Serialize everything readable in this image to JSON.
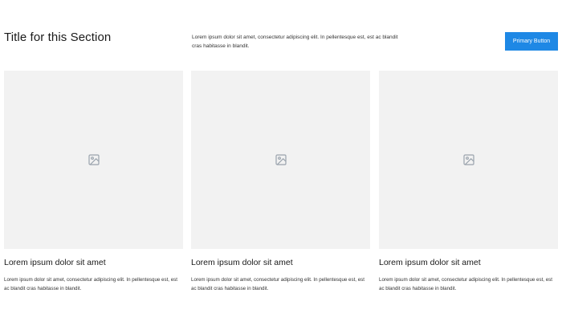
{
  "header": {
    "title": "Title for this Section",
    "description": "Lorem ipsum dolor sit amet, consectetur adipiscing elit. In pellentesque est, est ac blandit cras habitasse in blandit.",
    "primary_button_label": "Primary Button"
  },
  "colors": {
    "primary": "#1e88e5",
    "placeholder_bg": "#f2f2f2",
    "icon": "#9aa3ad"
  },
  "cards": [
    {
      "icon": "image-icon",
      "title": "Lorem ipsum dolor sit amet",
      "description": "Lorem ipsum dolor sit amet, consectetur adipiscing elit. In pellentesque est, est ac blandit cras habitasse in blandit."
    },
    {
      "icon": "image-icon",
      "title": "Lorem ipsum dolor sit amet",
      "description": "Lorem ipsum dolor sit amet, consectetur adipiscing elit. In pellentesque est, est ac blandit cras habitasse in blandit."
    },
    {
      "icon": "image-icon",
      "title": "Lorem ipsum dolor sit amet",
      "description": "Lorem ipsum dolor sit amet, consectetur adipiscing elit. In pellentesque est, est ac blandit cras habitasse in blandit."
    }
  ]
}
